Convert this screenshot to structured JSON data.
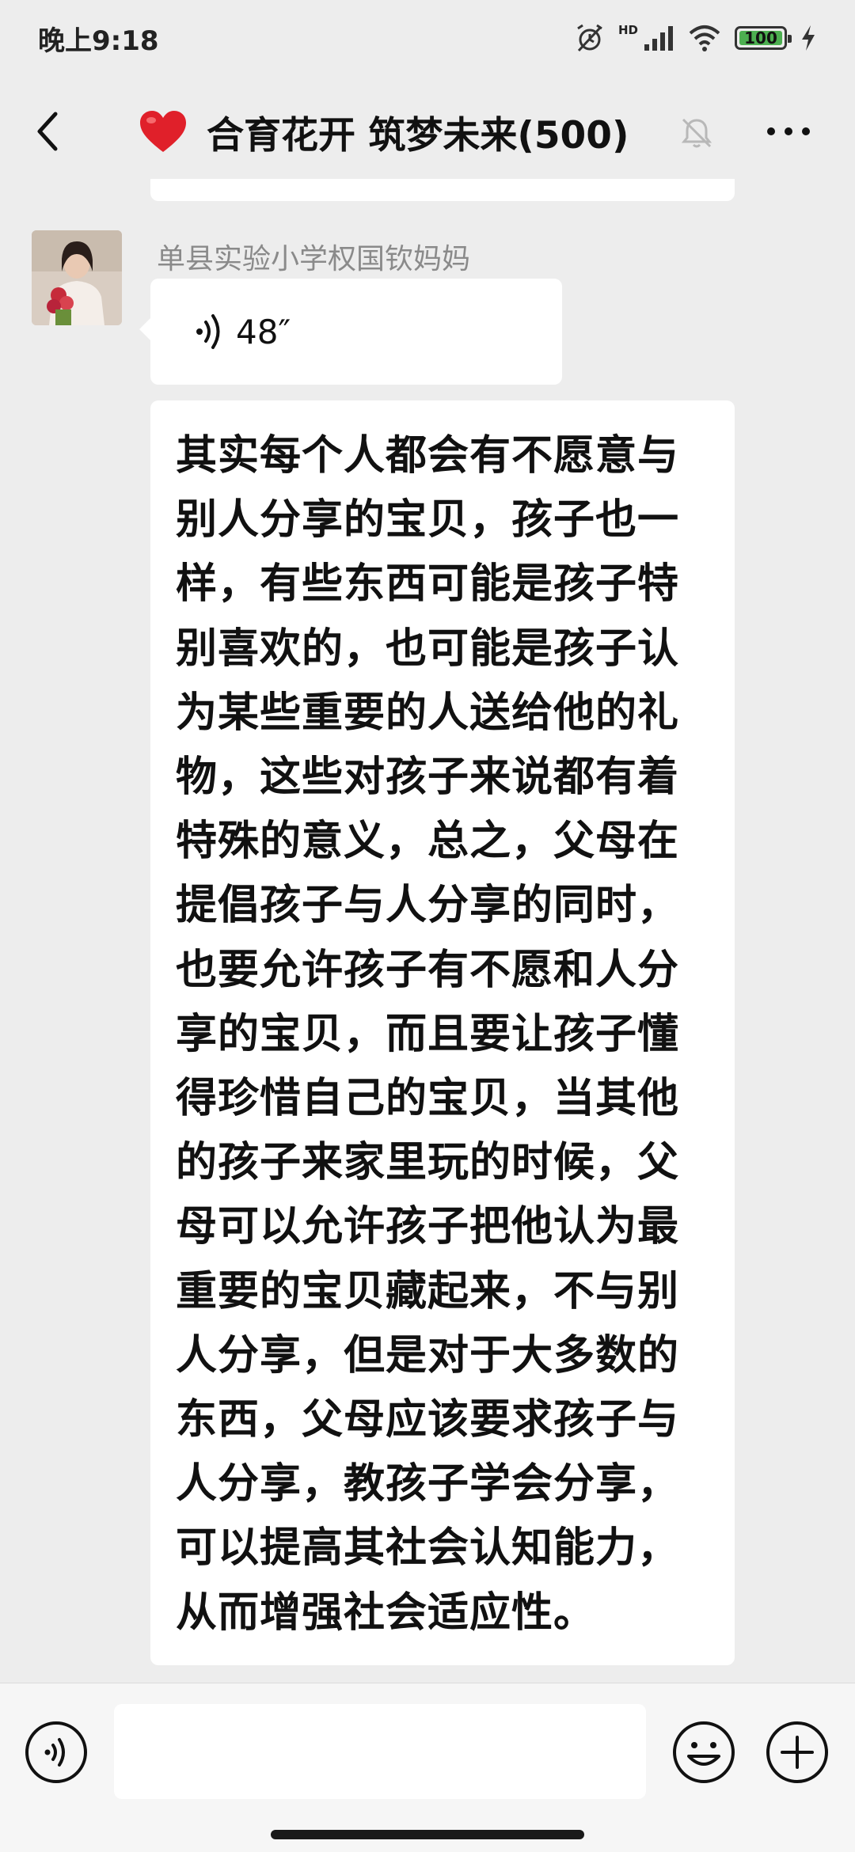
{
  "status_bar": {
    "time": "晚上9:18",
    "network_label": "HD",
    "battery_level": "100",
    "battery_fraction": 1.0
  },
  "header": {
    "title": "合育花开 筑梦未来(500)",
    "icons": [
      "back-arrow-icon",
      "heart-icon",
      "mute-bell-icon",
      "more-icon"
    ]
  },
  "messages": [
    {
      "sender": "单县实验小学权国钦妈妈",
      "voice_duration": "48″"
    },
    {
      "text": "其实每个人都会有不愿意与别人分享的宝贝，孩子也一样，有些东西可能是孩子特别喜欢的，也可能是孩子认为某些重要的人送给他的礼物，这些对孩子来说都有着特殊的意义，总之，父母在提倡孩子与人分享的同时，也要允许孩子有不愿和人分享的宝贝，而且要让孩子懂得珍惜自己的宝贝，当其他的孩子来家里玩的时候，父母可以允许孩子把他认为最重要的宝贝藏起来，不与别人分享，但是对于大多数的东西，父母应该要求孩子与人分享，教孩子学会分享，可以提高其社会认知能力，从而增强社会适应性。"
    }
  ],
  "input_bar": {
    "value": "",
    "icons": [
      "voice-toggle-icon",
      "emoji-icon",
      "plus-icon"
    ]
  },
  "colors": {
    "background": "#ededed",
    "bubble": "#ffffff",
    "battery": "#4caf50",
    "sender_name": "#8a8a8a"
  }
}
